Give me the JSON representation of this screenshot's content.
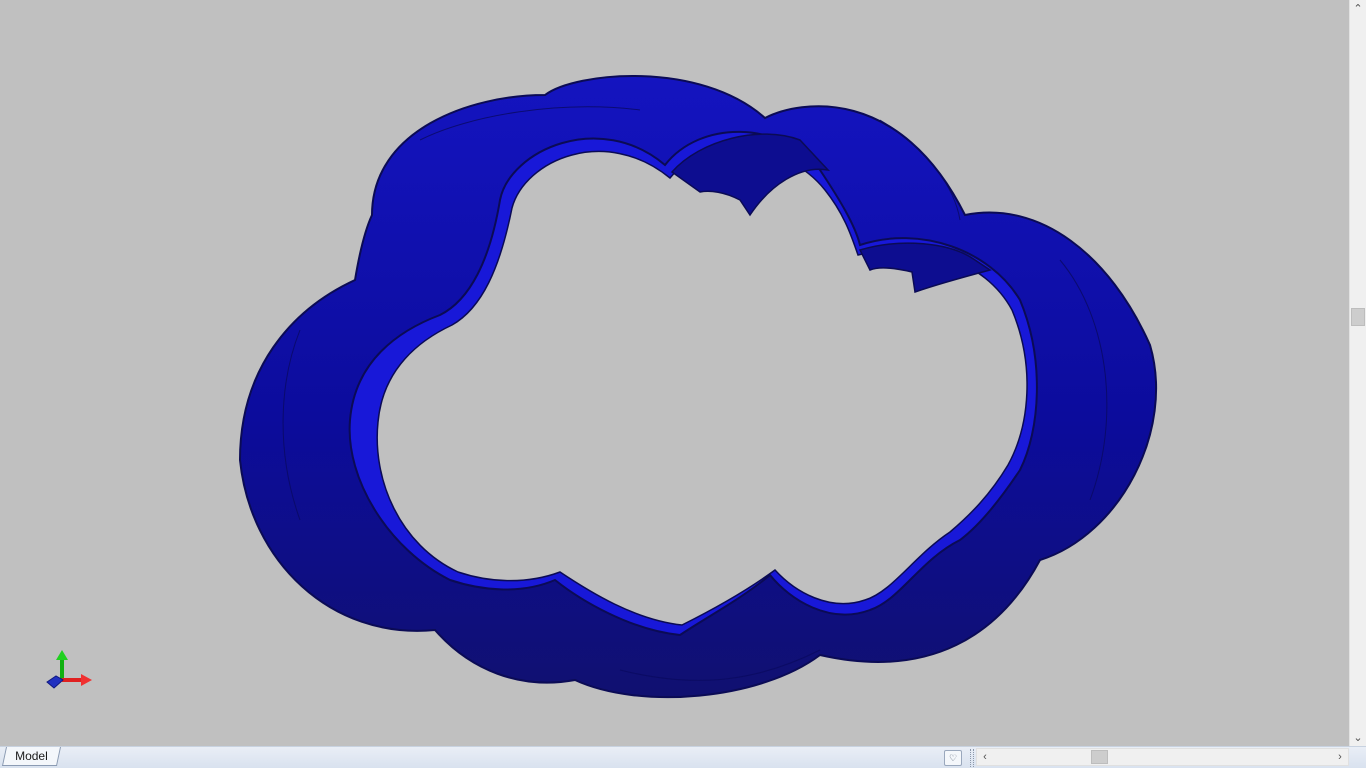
{
  "viewport": {
    "background": "#c0c0c0",
    "model": {
      "type": "cloud-shaped cookie cutter outline",
      "color": "#1010c8",
      "shade_color": "#0a0a8a",
      "edge_color": "#0b0b55"
    },
    "triad": {
      "x_axis_color": "#e02020",
      "y_axis_color": "#10b010",
      "z_axis_color": "#2030c0"
    }
  },
  "bottom_bar": {
    "tabs": [
      {
        "label": "Model",
        "active": true
      }
    ],
    "tab_menu_icon": "heart-chevron-icon"
  },
  "scrollbars": {
    "vertical": {
      "up_icon": "chevron-up-icon",
      "down_icon": "chevron-down-icon"
    },
    "horizontal": {
      "left_icon": "chevron-left-icon",
      "right_icon": "chevron-right-icon"
    }
  }
}
